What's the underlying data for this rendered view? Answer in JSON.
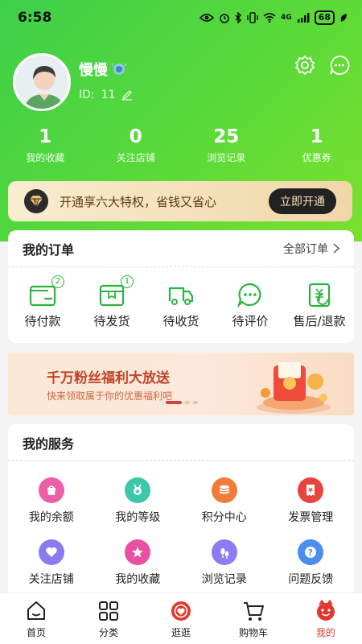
{
  "status_bar": {
    "time": "6:58",
    "network": "4G",
    "battery": "68"
  },
  "profile": {
    "username": "慢慢",
    "id_label": "ID:",
    "id_value": "11"
  },
  "stats": [
    {
      "value": "1",
      "label": "我的收藏"
    },
    {
      "value": "0",
      "label": "关注店铺"
    },
    {
      "value": "25",
      "label": "浏览记录"
    },
    {
      "value": "1",
      "label": "优惠券"
    }
  ],
  "vip": {
    "text": "开通享六大特权，省钱又省心",
    "button": "立即开通"
  },
  "orders": {
    "title": "我的订单",
    "more": "全部订单",
    "items": [
      {
        "label": "待付款",
        "badge": "2",
        "icon": "wallet-icon"
      },
      {
        "label": "待发货",
        "badge": "1",
        "icon": "package-icon"
      },
      {
        "label": "待收货",
        "icon": "truck-icon"
      },
      {
        "label": "待评价",
        "icon": "comment-icon"
      },
      {
        "label": "售后/退款",
        "icon": "refund-icon"
      }
    ]
  },
  "banner": {
    "title": "千万粉丝福利大放送",
    "subtitle": "快来领取属于你的优惠福利吧"
  },
  "services": {
    "title": "我的服务",
    "items": [
      {
        "label": "我的余额",
        "icon": "balance-icon",
        "color": "#ec5fa6"
      },
      {
        "label": "我的等级",
        "icon": "level-icon",
        "color": "#3cc7a8"
      },
      {
        "label": "积分中心",
        "icon": "points-icon",
        "color": "#f07c3a"
      },
      {
        "label": "发票管理",
        "icon": "invoice-icon",
        "color": "#e9443f"
      },
      {
        "label": "关注店铺",
        "icon": "heart-icon",
        "color": "#8a7cf0"
      },
      {
        "label": "我的收藏",
        "icon": "star-icon",
        "color": "#ea4fa4"
      },
      {
        "label": "浏览记录",
        "icon": "footprint-icon",
        "color": "#8e7bf2"
      },
      {
        "label": "问题反馈",
        "icon": "question-icon",
        "color": "#4a8ff0"
      }
    ]
  },
  "tabbar": [
    {
      "label": "首页",
      "icon": "home-icon"
    },
    {
      "label": "分类",
      "icon": "grid-icon"
    },
    {
      "label": "逛逛",
      "icon": "explore-icon"
    },
    {
      "label": "购物车",
      "icon": "cart-icon"
    },
    {
      "label": "我的",
      "icon": "profile-icon",
      "active": true
    }
  ],
  "colors": {
    "header_green": "#4fd63c",
    "accent_green": "#2bb33f",
    "active_red": "#e03a2f"
  }
}
